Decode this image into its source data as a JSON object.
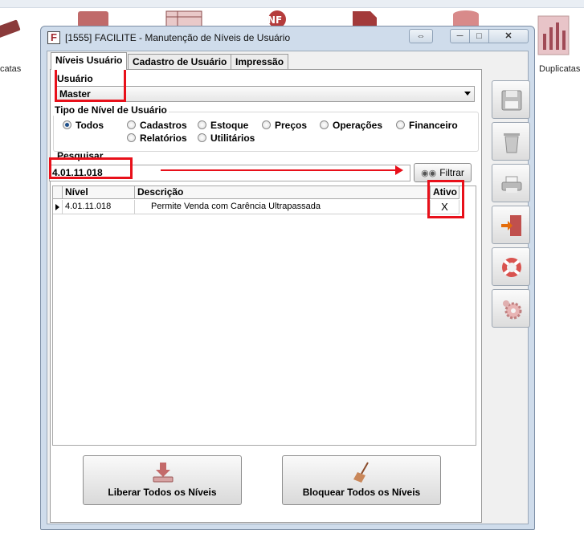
{
  "desktop": {
    "left_label": "catas",
    "right_label": "Duplicatas"
  },
  "window": {
    "title": "[1555] FACILITE - Manutenção de Níveis de Usuário",
    "icon_letter": "F",
    "swap_label": "⇔",
    "min_label": "─",
    "max_label": "□",
    "close_label": "✕"
  },
  "tabs": [
    {
      "label": "Níveis Usuário",
      "active": true
    },
    {
      "label": "Cadastro de Usuário",
      "active": false
    },
    {
      "label": "Impressão",
      "active": false
    }
  ],
  "usuario": {
    "label": "Usuário",
    "selected": "Master"
  },
  "tipo_nivel": {
    "legend": "Tipo de Nível de Usuário",
    "options": [
      {
        "label": "Todos",
        "checked": true
      },
      {
        "label": "Cadastros",
        "checked": false
      },
      {
        "label": "Estoque",
        "checked": false
      },
      {
        "label": "Preços",
        "checked": false
      },
      {
        "label": "Operações",
        "checked": false
      },
      {
        "label": "Financeiro",
        "checked": false
      },
      {
        "label": "Relatórios",
        "checked": false
      },
      {
        "label": "Utilitários",
        "checked": false
      }
    ]
  },
  "pesquisar": {
    "label": "Pesquisar",
    "value": "4.01.11.018"
  },
  "filter_button": {
    "label": "Filtrar"
  },
  "grid": {
    "headers": [
      "Nível",
      "Descrição",
      "Ativo"
    ],
    "rows": [
      {
        "nivel": "4.01.11.018",
        "descricao": "Permite Venda com Carência Ultrapassada",
        "ativo": "X"
      }
    ]
  },
  "buttons": {
    "liberar": "Liberar Todos os Níveis",
    "bloquear": "Bloquear Todos os Níveis"
  },
  "side_toolbar": [
    "save-icon",
    "trash-icon",
    "printer-icon",
    "exit-door-icon",
    "lifebuoy-help-icon",
    "settings-gear-icon"
  ],
  "colors": {
    "highlight": "#e8101a",
    "window_frame": "#cfdceb"
  }
}
